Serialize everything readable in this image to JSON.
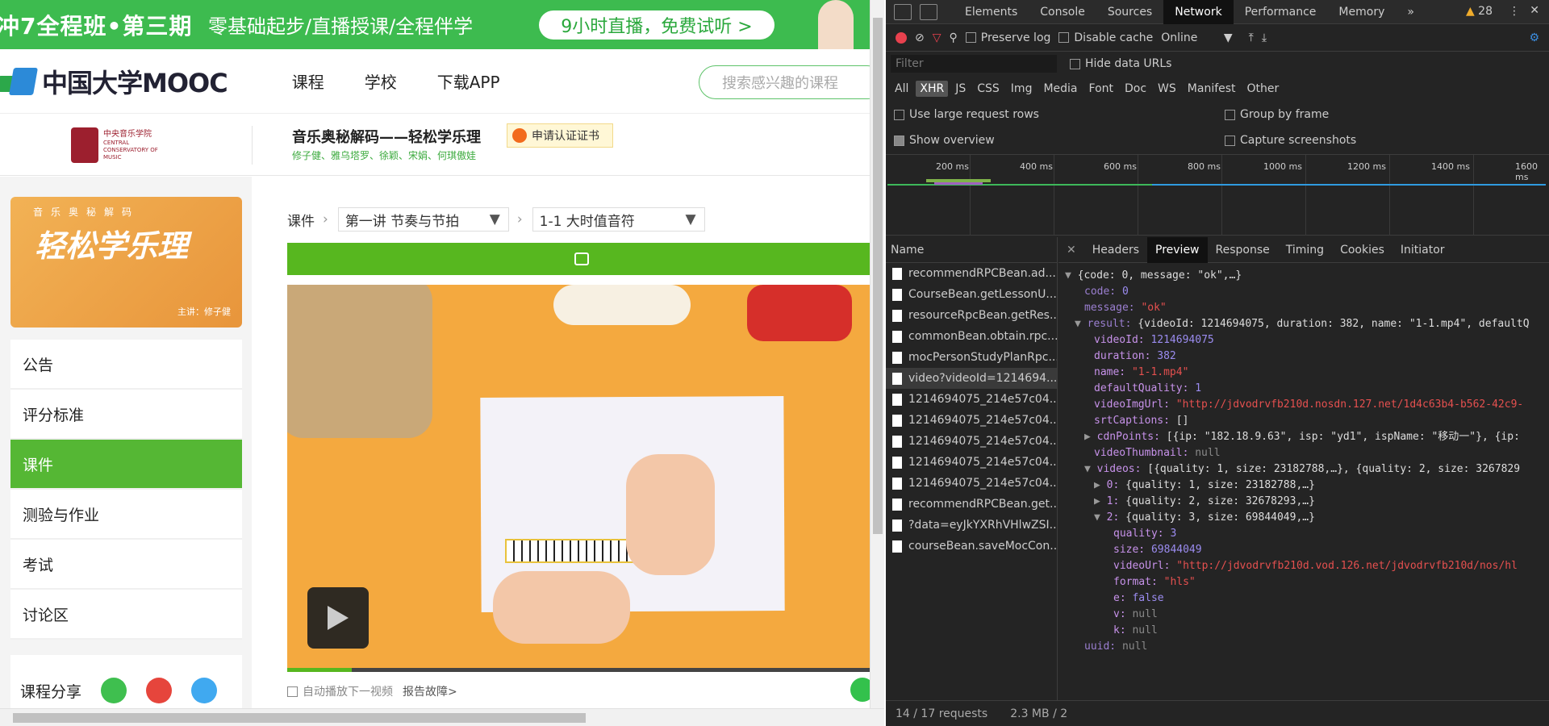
{
  "site": {
    "banner": {
      "title": "冲7全程班•第三期",
      "slogan": "零基础起步/直播授课/全程伴学",
      "cta": "9小时直播，免费试听 >"
    },
    "logo_text": "中国大学MOOC",
    "nav": [
      "课程",
      "学校",
      "下载APP"
    ],
    "search_placeholder": "搜索感兴趣的课程",
    "school_name_cn": "中央音乐学院",
    "school_name_en": "CENTRAL CONSERVATORY OF MUSIC",
    "course_title": "音乐奥秘解码——轻松学乐理",
    "course_teachers": "修子健、雅乌塔罗、徐颖、宋娟、何琪傲娃",
    "cert_button": "申请认证证书",
    "cover_small": "音乐奥秘解码",
    "cover_big": "轻松学乐理",
    "cover_teacher": "主讲：修子健",
    "menu": [
      "公告",
      "评分标准",
      "课件",
      "测验与作业",
      "考试",
      "讨论区"
    ],
    "active_menu_index": 2,
    "share_label": "课程分享",
    "breadcrumb_root": "课件",
    "lecture_select": "第一讲 节奏与节拍",
    "lesson_select": "1-1 大时值音符",
    "video_progress_pct": 11,
    "autoplay_label": "自动播放下一视频",
    "report_link": "报告故障>"
  },
  "devtools": {
    "tabs": [
      "Elements",
      "Console",
      "Sources",
      "Network",
      "Performance",
      "Memory"
    ],
    "active_tab": "Network",
    "more": "»",
    "warning_count": "28",
    "preserve_log": "Preserve log",
    "disable_cache": "Disable cache",
    "throttle": "Online",
    "filter_placeholder": "Filter",
    "hide_data_urls": "Hide data URLs",
    "types": [
      "All",
      "XHR",
      "JS",
      "CSS",
      "Img",
      "Media",
      "Font",
      "Doc",
      "WS",
      "Manifest",
      "Other"
    ],
    "active_type": "XHR",
    "opt_large_rows": "Use large request rows",
    "opt_group_frame": "Group by frame",
    "opt_show_overview": "Show overview",
    "opt_capture": "Capture screenshots",
    "timeline_ticks": [
      "200 ms",
      "400 ms",
      "600 ms",
      "800 ms",
      "1000 ms",
      "1200 ms",
      "1400 ms",
      "1600 ms"
    ],
    "name_header": "Name",
    "requests": [
      "recommendRPCBean.ad...",
      "CourseBean.getLessonU...",
      "resourceRpcBean.getRes...",
      "commonBean.obtain.rpc...",
      "mocPersonStudyPlanRpc...",
      "video?videoId=1214694...",
      "1214694075_214e57c04...",
      "1214694075_214e57c04...",
      "1214694075_214e57c04...",
      "1214694075_214e57c04...",
      "1214694075_214e57c04...",
      "recommendRPCBean.get...",
      "?data=eyJkYXRhVHlwZSI...",
      "courseBean.saveMocCon..."
    ],
    "selected_request_index": 5,
    "detail_tabs": [
      "Headers",
      "Preview",
      "Response",
      "Timing",
      "Cookies",
      "Initiator"
    ],
    "active_detail_tab": "Preview",
    "status_requests": "14 / 17 requests",
    "status_size": "2.3 MB / 2",
    "json_lines": [
      {
        "i": 0,
        "arrow": "▼",
        "k": "",
        "v": "{code: 0, message: \"ok\",…}",
        "c": "w"
      },
      {
        "i": 1,
        "arrow": "",
        "k": "code",
        "v": "0",
        "c": "n"
      },
      {
        "i": 1,
        "arrow": "",
        "k": "message",
        "v": "\"ok\"",
        "c": "s"
      },
      {
        "i": 1,
        "arrow": "▼",
        "k": "result",
        "v": "{videoId: 1214694075, duration: 382, name: \"1-1.mp4\", defaultQ",
        "c": "w"
      },
      {
        "i": 2,
        "arrow": "",
        "k": "videoId",
        "v": "1214694075",
        "c": "n"
      },
      {
        "i": 2,
        "arrow": "",
        "k": "duration",
        "v": "382",
        "c": "n"
      },
      {
        "i": 2,
        "arrow": "",
        "k": "name",
        "v": "\"1-1.mp4\"",
        "c": "s"
      },
      {
        "i": 2,
        "arrow": "",
        "k": "defaultQuality",
        "v": "1",
        "c": "n"
      },
      {
        "i": 2,
        "arrow": "",
        "k": "videoImgUrl",
        "v": "\"http://jdvodrvfb210d.nosdn.127.net/1d4c63b4-b562-42c9-",
        "c": "s"
      },
      {
        "i": 2,
        "arrow": "",
        "k": "srtCaptions",
        "v": "[]",
        "c": "w"
      },
      {
        "i": 2,
        "arrow": "▶",
        "k": "cdnPoints",
        "v": "[{ip: \"182.18.9.63\", isp: \"yd1\", ispName: \"移动一\"}, {ip:",
        "c": "w"
      },
      {
        "i": 2,
        "arrow": "",
        "k": "videoThumbnail",
        "v": "null",
        "c": "nl"
      },
      {
        "i": 2,
        "arrow": "▼",
        "k": "videos",
        "v": "[{quality: 1, size: 23182788,…}, {quality: 2, size: 3267829",
        "c": "w"
      },
      {
        "i": 3,
        "arrow": "▶",
        "k": "0",
        "v": "{quality: 1, size: 23182788,…}",
        "c": "w"
      },
      {
        "i": 3,
        "arrow": "▶",
        "k": "1",
        "v": "{quality: 2, size: 32678293,…}",
        "c": "w"
      },
      {
        "i": 3,
        "arrow": "▼",
        "k": "2",
        "v": "{quality: 3, size: 69844049,…}",
        "c": "w"
      },
      {
        "i": 4,
        "arrow": "",
        "k": "quality",
        "v": "3",
        "c": "n"
      },
      {
        "i": 4,
        "arrow": "",
        "k": "size",
        "v": "69844049",
        "c": "n"
      },
      {
        "i": 4,
        "arrow": "",
        "k": "videoUrl",
        "v": "\"http://jdvodrvfb210d.vod.126.net/jdvodrvfb210d/nos/hl",
        "c": "s"
      },
      {
        "i": 4,
        "arrow": "",
        "k": "format",
        "v": "\"hls\"",
        "c": "s"
      },
      {
        "i": 4,
        "arrow": "",
        "k": "e",
        "v": "false",
        "c": "n"
      },
      {
        "i": 4,
        "arrow": "",
        "k": "v",
        "v": "null",
        "c": "nl"
      },
      {
        "i": 4,
        "arrow": "",
        "k": "k",
        "v": "null",
        "c": "nl"
      },
      {
        "i": 1,
        "arrow": "",
        "k": "uuid",
        "v": "null",
        "c": "nl"
      }
    ]
  }
}
